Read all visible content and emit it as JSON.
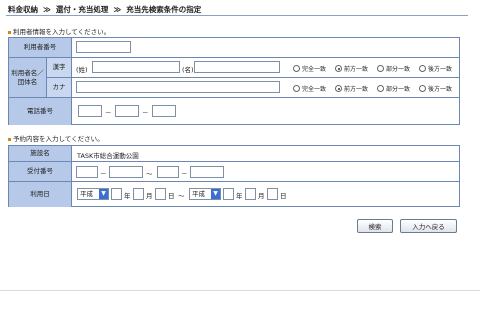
{
  "breadcrumb": {
    "items": [
      "料金収納",
      "還付・充当処理",
      "充当先検索条件の指定"
    ],
    "separator": "≫"
  },
  "user_section": {
    "note": "利用者情報を入力してください。",
    "user_number_label": "利用者番号",
    "user_number_value": "",
    "name_group_label": "利用者名／団体名",
    "kanji_label": "漢字",
    "kana_label": "カナ",
    "sei_label": "(姓)",
    "mei_label": "(名)",
    "match_options": [
      "完全一致",
      "前方一致",
      "部分一致",
      "後方一致"
    ],
    "kanji_selected": "前方一致",
    "kana_selected": "前方一致",
    "phone_label": "電話番号",
    "phone_separator": "－"
  },
  "reservation_section": {
    "note": "予約内容を入力してください。",
    "facility_label": "施設名",
    "facility_value": "TASK市総合運動公園",
    "receipt_label": "受付番号",
    "receipt_separator": "－",
    "range_separator": "～",
    "date_label": "利用日",
    "era_value": "平成",
    "year_unit": "年",
    "month_unit": "月",
    "day_unit": "日"
  },
  "buttons": {
    "search": "検索",
    "back": "入力へ戻る"
  }
}
